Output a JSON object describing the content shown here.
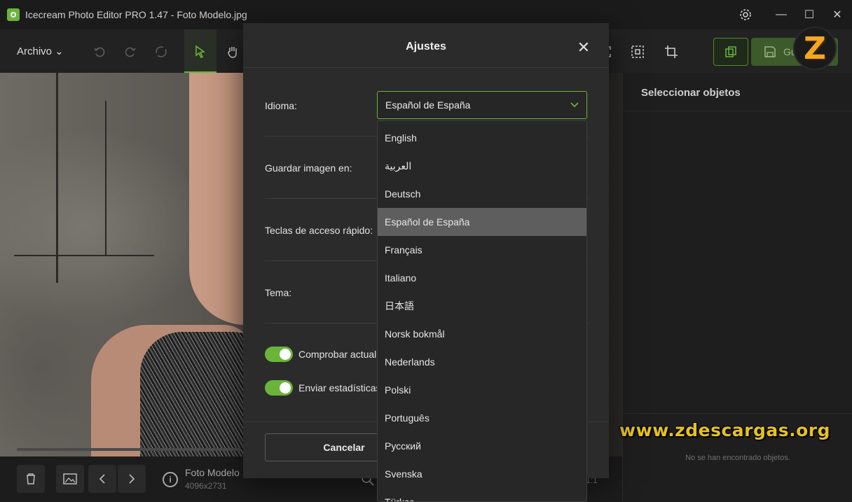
{
  "window": {
    "title": "Icecream Photo Editor PRO 1.47 - Foto Modelo.jpg",
    "controls": {
      "settings": "gear-icon",
      "minimize": "—",
      "maximize": "☐",
      "close": "✕"
    }
  },
  "toolbar": {
    "archivo_label": "Archivo ⌄",
    "save_label": "Guardar"
  },
  "panel": {
    "title": "Seleccionar objetos",
    "empty_text": "No se han encontrado objetos."
  },
  "bottom": {
    "file_name": "Foto Modelo",
    "file_size": "4096x2731",
    "ratio": "1:1"
  },
  "dialog": {
    "title": "Ajustes",
    "close": "✕",
    "language_label": "Idioma:",
    "language_value": "Español de España",
    "save_in_label": "Guardar imagen en:",
    "hotkeys_label": "Teclas de acceso rápido:",
    "theme_label": "Tema:",
    "check_updates_label": "Comprobar actuali",
    "send_stats_label": "Enviar estadísticas",
    "cancel_label": "Cancelar"
  },
  "language_options": [
    "English",
    "العربية",
    "Deutsch",
    "Español de España",
    "Français",
    "Italiano",
    "日本語",
    "Norsk bokmål",
    "Nederlands",
    "Polski",
    "Português",
    "Русский",
    "Svenska",
    "Türkçe"
  ],
  "selected_language": "Español de España",
  "watermark": {
    "logo_letter": "Z",
    "url": "www.zdescargas.org"
  },
  "colors": {
    "accent": "#6bb43a",
    "background": "#1d1d1d",
    "dialog": "#2b2b2b",
    "watermark": "#e8c21c"
  }
}
